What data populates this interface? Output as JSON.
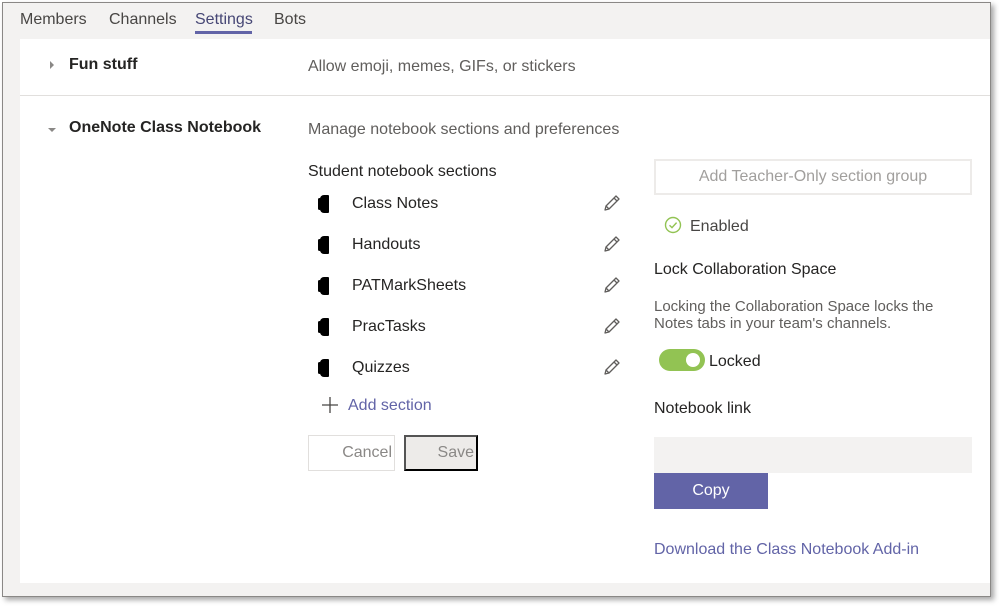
{
  "tabs": [
    {
      "label": "Members"
    },
    {
      "label": "Channels"
    },
    {
      "label": "Settings"
    },
    {
      "label": "Bots"
    }
  ],
  "active_tab": "Settings",
  "fun_stuff": {
    "title": "Fun stuff",
    "description": "Allow emoji, memes, GIFs, or stickers"
  },
  "onenote": {
    "title": "OneNote Class Notebook",
    "description": "Manage notebook sections and preferences",
    "sections_heading": "Student notebook sections",
    "sections": [
      {
        "label": "Class Notes"
      },
      {
        "label": "Handouts"
      },
      {
        "label": "PATMarkSheets"
      },
      {
        "label": "PracTasks"
      },
      {
        "label": "Quizzes"
      }
    ],
    "add_section_label": "Add section",
    "cancel_label": "Cancel",
    "save_label": "Save",
    "teacher_only_label": "Add Teacher-Only section group",
    "enabled_label": "Enabled",
    "lock_heading": "Lock Collaboration Space",
    "lock_description": "Locking the Collaboration Space locks the Notes tabs in your team's channels.",
    "lock_toggle_state": "on",
    "locked_label": "Locked",
    "notebook_link_heading": "Notebook link",
    "notebook_link_value": "",
    "copy_label": "Copy",
    "download_link_label": "Download the Class Notebook Add-in"
  },
  "colors": {
    "accent": "#6264a7",
    "toggle_on": "#92c353",
    "enabled_check": "#92c353"
  }
}
